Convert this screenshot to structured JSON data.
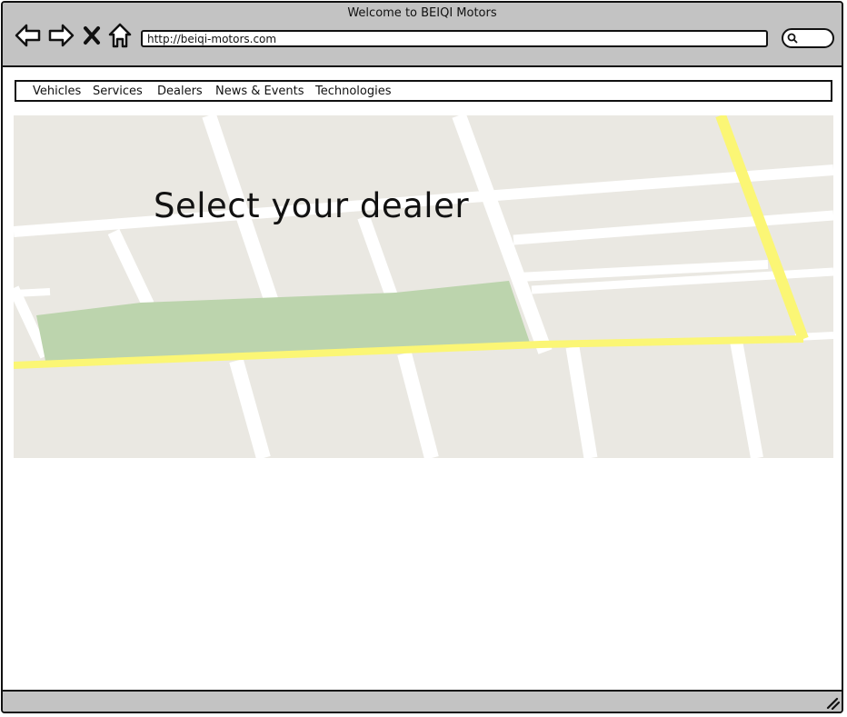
{
  "window": {
    "title": "Welcome to BEIQI Motors",
    "url": "http://beiqi-motors.com"
  },
  "toolbar": {
    "icons": [
      "back-arrow-icon",
      "forward-arrow-icon",
      "close-icon",
      "home-icon",
      "search-icon"
    ]
  },
  "menu": {
    "items": [
      {
        "label": "Vehicles"
      },
      {
        "label": "Services"
      },
      {
        "label": "Dealers"
      },
      {
        "label": "News & Events"
      },
      {
        "label": "Technologies"
      }
    ]
  },
  "map": {
    "heading": "Select your dealer",
    "colors": {
      "land": "#eae8e2",
      "street": "#ffffff",
      "highway": "#fbf675",
      "park": "#bcd4ad"
    }
  },
  "colors": {
    "chrome": "#c3c3c3",
    "border": "#111111"
  }
}
